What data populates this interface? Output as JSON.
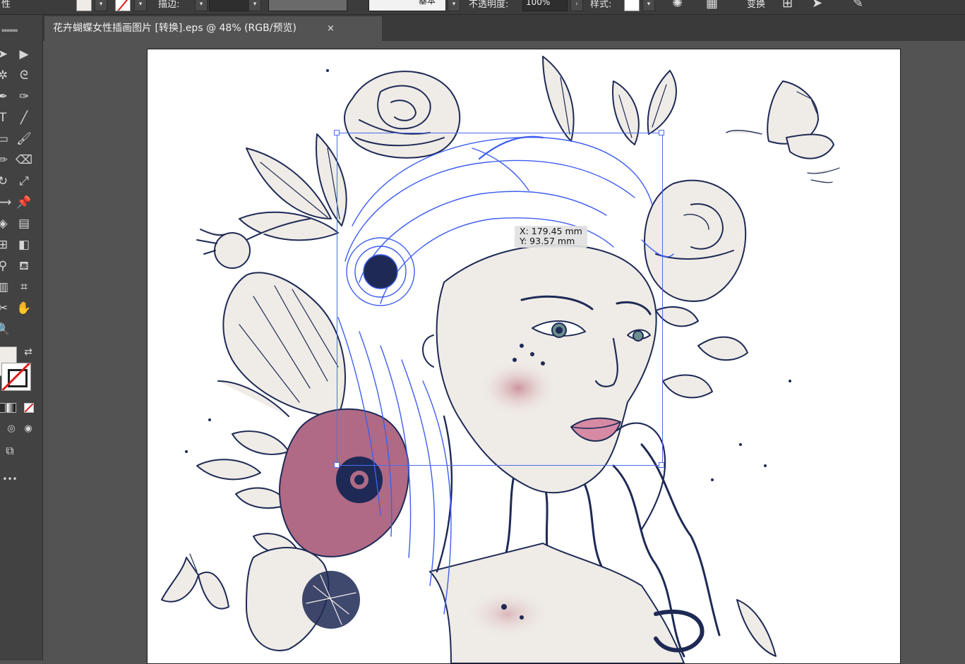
{
  "control_bar": {
    "label_attr": "性",
    "label_stroke": "描边:",
    "stroke_profile": "基本",
    "label_opacity": "不透明度:",
    "opacity_value": "100%",
    "label_style": "样式:",
    "transform_label": "变换"
  },
  "document_tab": {
    "title": "花卉蝴蝶女性插画图片  [转换].eps @ 48% (RGB/预览)",
    "close_glyph": "×"
  },
  "cursor_readout": {
    "x": "X: 179.45 mm",
    "y": "Y: 93.57 mm"
  },
  "colors": {
    "app_background": "#535353",
    "panel": "#424242",
    "artwork_line": "#1e2a55",
    "selection": "#3d5ef0",
    "fill_swatch": "#efebe6",
    "flower_pink": "#b06a86",
    "skin": "#efebe6",
    "lip_pink": "#d68aa4",
    "eye_teal": "#6c8f8f"
  },
  "toolbar": {
    "more_glyph": "•••"
  }
}
